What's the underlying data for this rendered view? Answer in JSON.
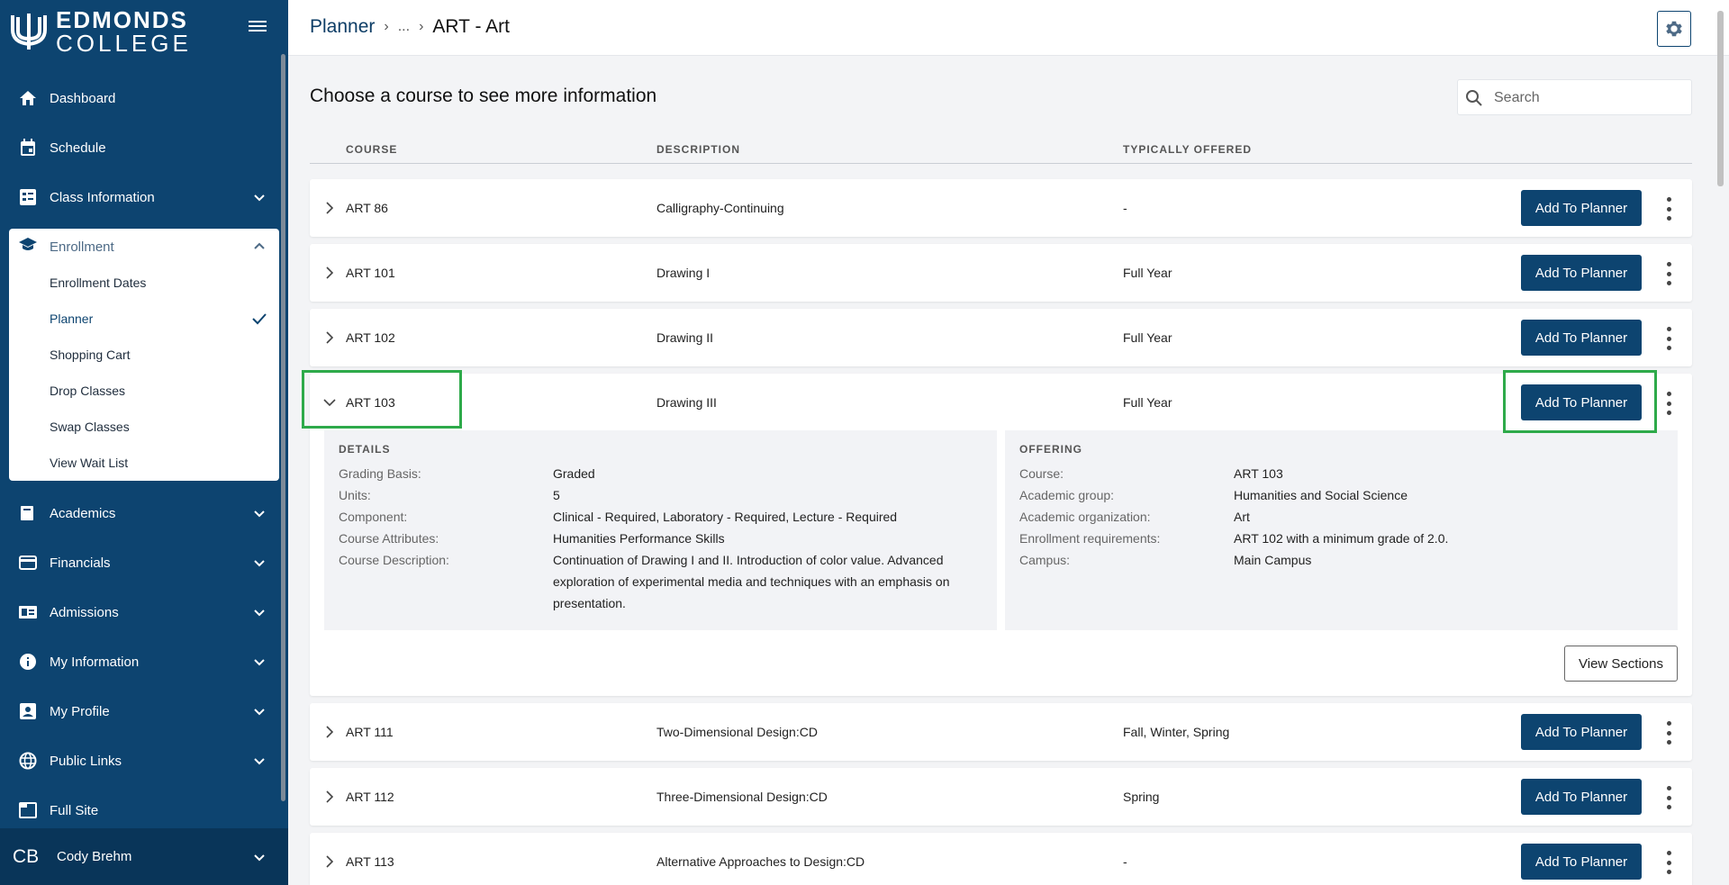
{
  "logo": {
    "line1": "EDMONDS",
    "line2": "COLLEGE"
  },
  "nav": [
    {
      "id": "dashboard",
      "label": "Dashboard",
      "icon": "home-icon",
      "expandable": false
    },
    {
      "id": "schedule",
      "label": "Schedule",
      "icon": "calendar-icon",
      "expandable": false
    },
    {
      "id": "class-information",
      "label": "Class Information",
      "icon": "list-icon",
      "expandable": true
    },
    {
      "id": "academics",
      "label": "Academics",
      "icon": "book-icon",
      "expandable": true
    },
    {
      "id": "financials",
      "label": "Financials",
      "icon": "credit-card-icon",
      "expandable": true
    },
    {
      "id": "admissions",
      "label": "Admissions",
      "icon": "id-card-icon",
      "expandable": true
    },
    {
      "id": "my-information",
      "label": "My Information",
      "icon": "info-icon",
      "expandable": true
    },
    {
      "id": "my-profile",
      "label": "My Profile",
      "icon": "profile-icon",
      "expandable": true
    },
    {
      "id": "public-links",
      "label": "Public Links",
      "icon": "globe-icon",
      "expandable": true
    },
    {
      "id": "full-site",
      "label": "Full Site",
      "icon": "window-icon",
      "expandable": false
    }
  ],
  "enrollment": {
    "label": "Enrollment",
    "items": [
      {
        "label": "Enrollment Dates",
        "active": false
      },
      {
        "label": "Planner",
        "active": true
      },
      {
        "label": "Shopping Cart",
        "active": false
      },
      {
        "label": "Drop Classes",
        "active": false
      },
      {
        "label": "Swap Classes",
        "active": false
      },
      {
        "label": "View Wait List",
        "active": false
      }
    ]
  },
  "user": {
    "initials": "CB",
    "name": "Cody Brehm"
  },
  "breadcrumb": {
    "root": "Planner",
    "ellipsis": "...",
    "current": "ART - Art"
  },
  "page_title": "Choose a course to see more information",
  "search": {
    "placeholder": "Search",
    "value": ""
  },
  "columns": {
    "course": "COURSE",
    "description": "DESCRIPTION",
    "offered": "TYPICALLY OFFERED"
  },
  "add_button_label": "Add To Planner",
  "courses": [
    {
      "code": "ART 86",
      "desc": "Calligraphy-Continuing",
      "offered": "-"
    },
    {
      "code": "ART 101",
      "desc": "Drawing I",
      "offered": "Full Year"
    },
    {
      "code": "ART 102",
      "desc": "Drawing II",
      "offered": "Full Year"
    },
    {
      "code": "ART 103",
      "desc": "Drawing III",
      "offered": "Full Year",
      "expanded": true
    },
    {
      "code": "ART 111",
      "desc": "Two-Dimensional Design:CD",
      "offered": "Fall, Winter, Spring"
    },
    {
      "code": "ART 112",
      "desc": "Three-Dimensional Design:CD",
      "offered": "Spring"
    },
    {
      "code": "ART 113",
      "desc": "Alternative Approaches to Design:CD",
      "offered": "-"
    }
  ],
  "details": {
    "title": "DETAILS",
    "grading_basis_k": "Grading Basis:",
    "grading_basis_v": "Graded",
    "units_k": "Units:",
    "units_v": "5",
    "component_k": "Component:",
    "component_v": "Clinical - Required, Laboratory - Required, Lecture - Required",
    "attributes_k": "Course Attributes:",
    "attributes_v": "Humanities Performance Skills",
    "description_k": "Course Description:",
    "description_v": "Continuation of Drawing I and II. Introduction of color value. Advanced exploration of experimental media and techniques with an emphasis on presentation."
  },
  "offering": {
    "title": "OFFERING",
    "course_k": "Course:",
    "course_v": "ART 103",
    "group_k": "Academic group:",
    "group_v": "Humanities and Social Science",
    "org_k": "Academic organization:",
    "org_v": "Art",
    "req_k": "Enrollment requirements:",
    "req_v": "ART 102 with a minimum grade of 2.0.",
    "campus_k": "Campus:",
    "campus_v": "Main Campus"
  },
  "view_sections_label": "View Sections",
  "colors": {
    "brand": "#0d4470",
    "highlight": "#2eaa4a"
  }
}
